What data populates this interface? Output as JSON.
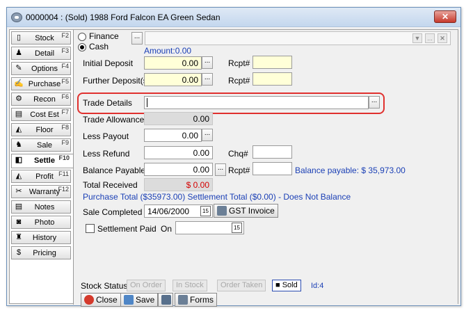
{
  "window": {
    "title": "0000004 : (Sold) 1988 Ford Falcon EA Green Sedan",
    "close_glyph": "✕"
  },
  "nav": [
    {
      "label": "Stock",
      "fkey": "F2",
      "icon": "stock-icon",
      "glyph": "▯"
    },
    {
      "label": "Detail",
      "fkey": "F3",
      "icon": "person-icon",
      "glyph": "♟"
    },
    {
      "label": "Options",
      "fkey": "F4",
      "icon": "options-icon",
      "glyph": "✎"
    },
    {
      "label": "Purchase",
      "fkey": "F5",
      "icon": "purchase-icon",
      "glyph": "✍"
    },
    {
      "label": "Recon",
      "fkey": "F6",
      "icon": "recon-icon",
      "glyph": "⚙"
    },
    {
      "label": "Cost Est",
      "fkey": "F7",
      "icon": "cost-icon",
      "glyph": "▤"
    },
    {
      "label": "Floor",
      "fkey": "F8",
      "icon": "floor-icon",
      "glyph": "◭"
    },
    {
      "label": "Sale",
      "fkey": "F9",
      "icon": "sale-icon",
      "glyph": "♞"
    },
    {
      "label": "Settle",
      "fkey": "F10",
      "icon": "settle-icon",
      "glyph": "◧"
    },
    {
      "label": "Profit",
      "fkey": "F11",
      "icon": "profit-icon",
      "glyph": "◭"
    },
    {
      "label": "Warranty",
      "fkey": "F12",
      "icon": "warranty-icon",
      "glyph": "✂"
    },
    {
      "label": "Notes",
      "fkey": "",
      "icon": "notes-icon",
      "glyph": "▤"
    },
    {
      "label": "Photo",
      "fkey": "",
      "icon": "photo-icon",
      "glyph": "◙"
    },
    {
      "label": "History",
      "fkey": "",
      "icon": "history-icon",
      "glyph": "♜"
    },
    {
      "label": "Pricing",
      "fkey": "",
      "icon": "pricing-icon",
      "glyph": "$"
    }
  ],
  "payment": {
    "finance_label": "Finance",
    "cash_label": "Cash",
    "selected": "Cash",
    "amount_label": "Amount:0.00"
  },
  "fields": {
    "initial_deposit": {
      "label": "Initial Deposit",
      "value": "0.00"
    },
    "further_deposits": {
      "label": "Further Deposit(s)",
      "value": "0.00"
    },
    "trade_details": {
      "label": "Trade Details",
      "value": ""
    },
    "trade_allowance": {
      "label": "Trade Allowance",
      "value": "0.00"
    },
    "less_payout": {
      "label": "Less Payout",
      "value": "0.00"
    },
    "less_refund": {
      "label": "Less Refund",
      "value": "0.00"
    },
    "balance_payable": {
      "label": "Balance Payable",
      "value": "0.00"
    },
    "total_received": {
      "label": "Total Received",
      "value": "$ 0.00"
    },
    "rcpt_label": "Rcpt#",
    "chq_label": "Chq#",
    "balance_payable_info": "Balance payable: $ 35,973.00"
  },
  "summary": "Purchase Total ($35973.00)   Settlement Total ($0.00) - Does Not Balance",
  "sale_completed": {
    "label": "Sale Completed",
    "date": "14/06/2000",
    "gst_label": "GST Invoice"
  },
  "settlement": {
    "paid_label": "Settlement Paid",
    "on_label": "On",
    "date": ""
  },
  "stock_status": {
    "label": "Stock Status",
    "options": [
      "On Order",
      "In Stock",
      "Order Taken",
      "Sold"
    ],
    "selected": "Sold",
    "id_label": "Id:4"
  },
  "toolbar": {
    "close_label": "Close",
    "save_label": "Save",
    "forms_label": "Forms"
  },
  "glyphs": {
    "ellipsis": "...",
    "dropdown": "▼",
    "cal": "15"
  }
}
